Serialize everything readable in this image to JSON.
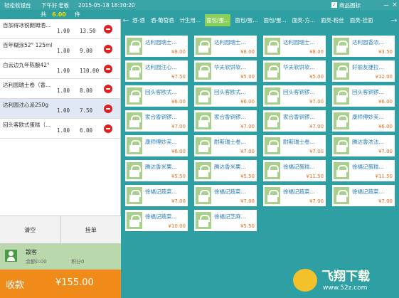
{
  "titlebar": {
    "app": "轻松收银台",
    "greeting": "下午好",
    "user": "老板",
    "datetime": "2015-05-18 18:30:20",
    "product_icon_label": "商品图标",
    "minimize": "－",
    "close": "×"
  },
  "total": {
    "label": "共",
    "amount": "6.00",
    "unit": "件"
  },
  "orders": [
    {
      "name": "百加得冰锐朗姆酒...",
      "qty": "1.00",
      "price": "13.50"
    },
    {
      "name": "百年糊涂52° 125ml",
      "qty": "1.00",
      "price": "9.00"
    },
    {
      "name": "白云边九年陈酿42°",
      "qty": "1.00",
      "price": "110.00"
    },
    {
      "name": "达利园瑞士卷（香...",
      "qty": "1.00",
      "price": "8.00"
    },
    {
      "name": "达利园注心派250g",
      "qty": "1.00",
      "price": "7.50"
    },
    {
      "name": "回头客欧式蛋糕（...",
      "qty": "1.00",
      "price": "6.00"
    }
  ],
  "actions": {
    "clear": "清空",
    "hold": "挂单"
  },
  "member": {
    "label": "散客",
    "balance": "余额0.00",
    "points": "积分0"
  },
  "pay": {
    "label": "收款",
    "amount": "¥155.00"
  },
  "categories": [
    "酒-酒",
    "酒-葡萄酒",
    "计生用...",
    "面包/蛋...",
    "面包/蛋...",
    "面包/蛋...",
    "面类-方...",
    "面类-粉丝",
    "面类-挂面"
  ],
  "products": [
    {
      "name": "达利园瑞士...",
      "price": "¥8.00"
    },
    {
      "name": "达利园瑞士...",
      "price": "¥8.00"
    },
    {
      "name": "达利园瑞士...",
      "price": "¥8.00"
    },
    {
      "name": "达利园香浓...",
      "price": "¥3.50"
    },
    {
      "name": "达利园注心...",
      "price": "¥7.50"
    },
    {
      "name": "华夫软饼软...",
      "price": "¥5.00"
    },
    {
      "name": "华夫软饼软...",
      "price": "¥5.00"
    },
    {
      "name": "好丽友捷拉...",
      "price": "¥12.00"
    },
    {
      "name": "回头客欧式...",
      "price": "¥6.00"
    },
    {
      "name": "回头客欧式...",
      "price": "¥6.00"
    },
    {
      "name": "回头客铜锣...",
      "price": "¥7.00"
    },
    {
      "name": "回头客铜锣...",
      "price": "¥6.00"
    },
    {
      "name": "家合香铜锣...",
      "price": "¥7.00"
    },
    {
      "name": "家合香铜锣...",
      "price": "¥7.00"
    },
    {
      "name": "家合香铜锣...",
      "price": "¥7.00"
    },
    {
      "name": "康师傅妙芙...",
      "price": "¥6.00"
    },
    {
      "name": "康师傅妙芙...",
      "price": "¥6.00"
    },
    {
      "name": "耐斯瑞士卷...",
      "price": "¥7.00"
    },
    {
      "name": "耐斯瑞士卷...",
      "price": "¥7.00"
    },
    {
      "name": "腾达香浓法...",
      "price": "¥7.00"
    },
    {
      "name": "腾达香米栗...",
      "price": "¥5.50"
    },
    {
      "name": "腾达香米栗...",
      "price": "¥5.50"
    },
    {
      "name": "徐福记蛋糕...",
      "price": "¥11.50"
    },
    {
      "name": "徐福记蛋糕...",
      "price": "¥11.50"
    },
    {
      "name": "徐福记蔬菜...",
      "price": "¥7.00"
    },
    {
      "name": "徐福记蔬菜...",
      "price": "¥7.00"
    },
    {
      "name": "徐福记蔬菜...",
      "price": "¥7.00"
    },
    {
      "name": "徐福记蔬菜...",
      "price": "¥7.00"
    },
    {
      "name": "徐福记蔬菜...",
      "price": "¥10.00"
    },
    {
      "name": "徐福记芝麻...",
      "price": "¥5.50"
    }
  ],
  "watermark": {
    "brand": "飞翔下载",
    "url": "www.52z.com"
  },
  "colors": {
    "accent": "#2e9fa2",
    "pay": "#f08a18",
    "active_category": "#8bd05a",
    "product_name": "#2a7fb8",
    "product_price": "#e07020"
  }
}
